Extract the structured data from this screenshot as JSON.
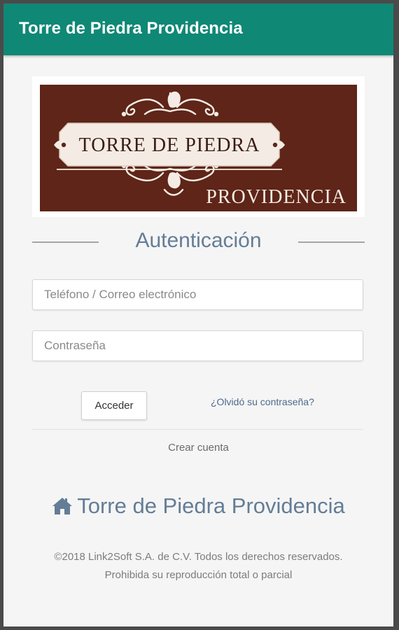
{
  "appbar": {
    "title": "Torre de Piedra Providencia"
  },
  "logo": {
    "line1": "TORRE DE PIEDRA",
    "line2": "PROVIDENCIA",
    "background_color": "#5e2518",
    "ornament_color": "#f4ece4"
  },
  "auth": {
    "title": "Autenticación",
    "user_placeholder": "Teléfono / Correo electrónico",
    "user_value": "",
    "password_placeholder": "Contraseña",
    "password_value": "",
    "login_label": "Acceder",
    "forgot_label": "¿Olvidó su contraseña?",
    "create_account_label": "Crear cuenta"
  },
  "footer": {
    "brand_icon": "home-icon",
    "brand_name": "Torre de Piedra Providencia",
    "copyright": "©2018 Link2Soft S.A. de C.V. Todos los derechos reservados. Prohibida su reproducción total o parcial"
  },
  "colors": {
    "appbar": "#0f8876",
    "accent_text": "#647d96",
    "link": "#4c6b8a"
  }
}
